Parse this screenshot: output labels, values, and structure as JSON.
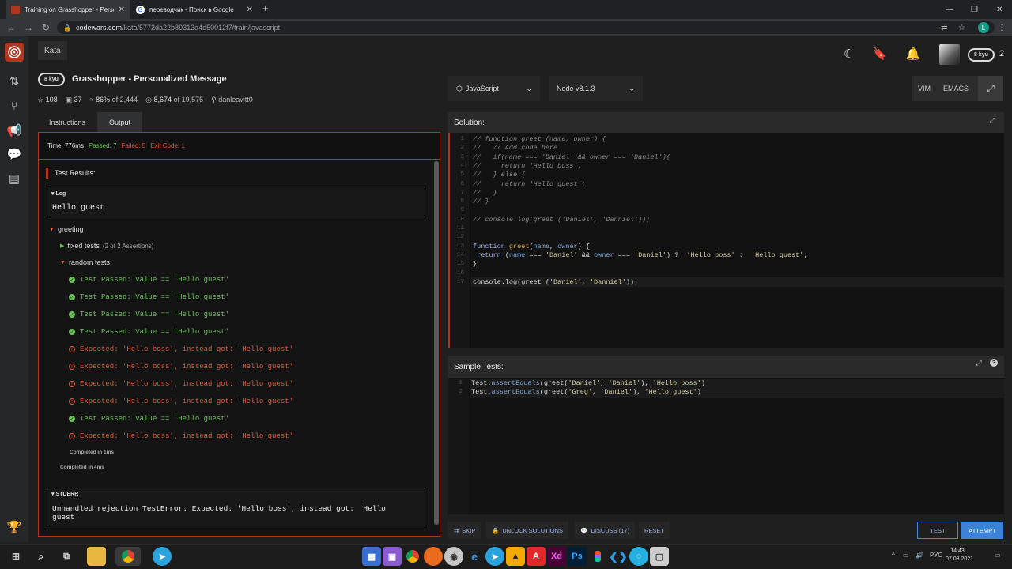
{
  "browser": {
    "tabs": [
      {
        "title": "Training on Grasshopper - Perso",
        "icon_color": "#b1361e"
      },
      {
        "title": "переводчик - Поиск в Google",
        "icon_color": "#4285f4"
      }
    ],
    "new_tab": "+",
    "url_host": "codewars.com",
    "url_path": "/kata/5772da22b89313a4d50012f7/train/javascript",
    "profile_initial": "L"
  },
  "nav": {
    "kata_tab": "Kata",
    "honor": "2",
    "rank": "8 kyu"
  },
  "kata": {
    "rank": "8 kyu",
    "title": "Grasshopper - Personalized Message",
    "stars": "108",
    "forks": "37",
    "satisfaction": "86%",
    "satisfaction_of": "of 2,444",
    "completed": "8,674",
    "completed_of": "of 19,575",
    "author": "danleavitt0"
  },
  "left_tabs": {
    "instructions": "Instructions",
    "output": "Output"
  },
  "output": {
    "time": "Time: 776ms",
    "passed": "Passed: 7",
    "failed": "Failed: 5",
    "exit": "Exit Code: 1",
    "test_results": "Test Results:",
    "log_label": "Log",
    "log_text": "Hello guest",
    "group": "greeting",
    "fixed_tests": "fixed tests",
    "fixed_tests_detail": "(2 of 2 Assertions)",
    "random_tests": "random tests",
    "lines": [
      {
        "ok": true,
        "text": "Test Passed: Value == 'Hello guest'"
      },
      {
        "ok": true,
        "text": "Test Passed: Value == 'Hello guest'"
      },
      {
        "ok": true,
        "text": "Test Passed: Value == 'Hello guest'"
      },
      {
        "ok": true,
        "text": "Test Passed: Value == 'Hello guest'"
      },
      {
        "ok": false,
        "text": "Expected: 'Hello boss', instead got: 'Hello guest'"
      },
      {
        "ok": false,
        "text": "Expected: 'Hello boss', instead got: 'Hello guest'"
      },
      {
        "ok": false,
        "text": "Expected: 'Hello boss', instead got: 'Hello guest'"
      },
      {
        "ok": false,
        "text": "Expected: 'Hello boss', instead got: 'Hello guest'"
      },
      {
        "ok": true,
        "text": "Test Passed: Value == 'Hello guest'"
      },
      {
        "ok": false,
        "text": "Expected: 'Hello boss', instead got: 'Hello guest'"
      }
    ],
    "completed_inner": "Completed in 1ms",
    "completed_outer": "Completed in 4ms",
    "stderr_label": "STDERR",
    "stderr_text": "Unhandled rejection TestError: Expected: 'Hello boss', instead got: 'Hello guest'"
  },
  "toolbar": {
    "language": "JavaScript",
    "version": "Node v8.1.3",
    "vim": "VIM",
    "emacs": "EMACS"
  },
  "solution": {
    "header": "Solution:",
    "line_numbers": [
      "1",
      "2",
      "3",
      "4",
      "5",
      "6",
      "7",
      "8",
      "9",
      "10",
      "11",
      "12",
      "13",
      "14",
      "15",
      "16",
      "17"
    ],
    "comments": [
      "// function greet (name, owner) {",
      "//   // Add code here",
      "//   if(name === 'Daniel' && owner === 'Daniel'){",
      "//     return 'Hello boss';",
      "//   } else {",
      "//     return 'Hello guest';",
      "//   }",
      "// }",
      "",
      "// console.log(greet ('Daniel', 'Danniel'));"
    ],
    "line13_kw": "function",
    "line13_fn": "greet",
    "line13_p1": "name",
    "line13_p2": "owner",
    "line14_kw": "return",
    "line14_v1": "name",
    "line14_s1": "'Daniel'",
    "line14_v2": "owner",
    "line14_s2": "'Daniel'",
    "line14_s3": "'Hello boss'",
    "line14_s4": "'Hello guest'",
    "line15": "}",
    "line17_call": "console.log(greet (",
    "line17_s1": "'Daniel'",
    "line17_s2": "'Danniel'",
    "line17_end": "));"
  },
  "sample": {
    "header": "Sample Tests:",
    "line_numbers": [
      "1",
      "2"
    ],
    "l1_obj": "Test.",
    "l1_method": "assertEquals",
    "l1_call": "(greet(",
    "l1_s1": "'Daniel'",
    "l1_s2": "'Daniel'",
    "l1_s3": "'Hello boss'",
    "l2_obj": "Test.",
    "l2_method": "assertEquals",
    "l2_call": "(greet(",
    "l2_s1": "'Greg'",
    "l2_s2": "'Daniel'",
    "l2_s3": "'Hello guest'"
  },
  "bottom": {
    "skip": "SKIP",
    "unlock": "UNLOCK SOLUTIONS",
    "discuss": "DISCUSS (17)",
    "reset": "RESET",
    "test": "TEST",
    "attempt": "ATTEMPT"
  },
  "taskbar": {
    "lang": "РУС",
    "time": "14:43",
    "date": "07.03.2021"
  }
}
